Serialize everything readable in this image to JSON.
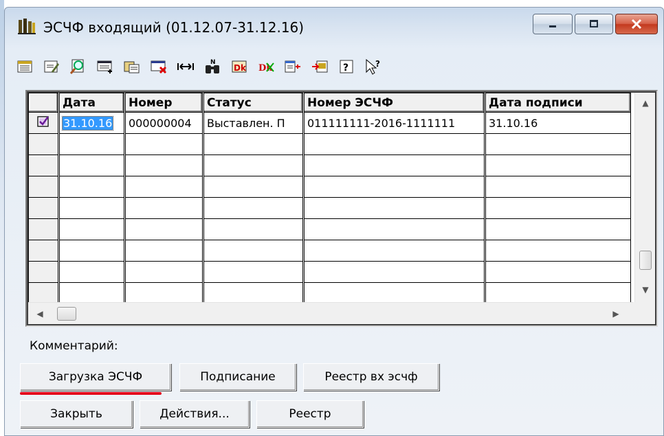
{
  "window": {
    "title": "ЭСЧФ входящий (01.12.07-31.12.16)",
    "controls": [
      "minimize-icon",
      "maximize-icon",
      "close-icon"
    ]
  },
  "toolbar": {
    "icons": [
      "list-icon",
      "edit-icon",
      "search-icon",
      "add-row-icon",
      "copy-icon",
      "delete-icon",
      "fit-width-icon",
      "find-icon",
      "debit-icon",
      "credit-icon",
      "export-icon",
      "import-icon",
      "help-icon",
      "context-help-icon"
    ]
  },
  "grid": {
    "columns": [
      "Дата",
      "Номер",
      "Статус",
      "Номер ЭСЧФ",
      "Дата подписи"
    ],
    "rows": [
      {
        "checked": true,
        "cells": [
          "31.10.16",
          "000000004",
          "Выставлен. П",
          "011111111-2016-1111111",
          "31.10.16"
        ]
      }
    ],
    "empty_rows": 8
  },
  "comment": {
    "label": "Комментарий:"
  },
  "buttons": {
    "load": "Загрузка ЭСЧФ",
    "sign": "Подписание",
    "registry_in": "Реестр вх эсчф",
    "close": "Закрыть",
    "actions": "Действия...",
    "registry": "Реестр"
  },
  "colors": {
    "selection": "#3399ff",
    "highlight_underline": "#e3001b",
    "close_button": "#c3391e"
  }
}
